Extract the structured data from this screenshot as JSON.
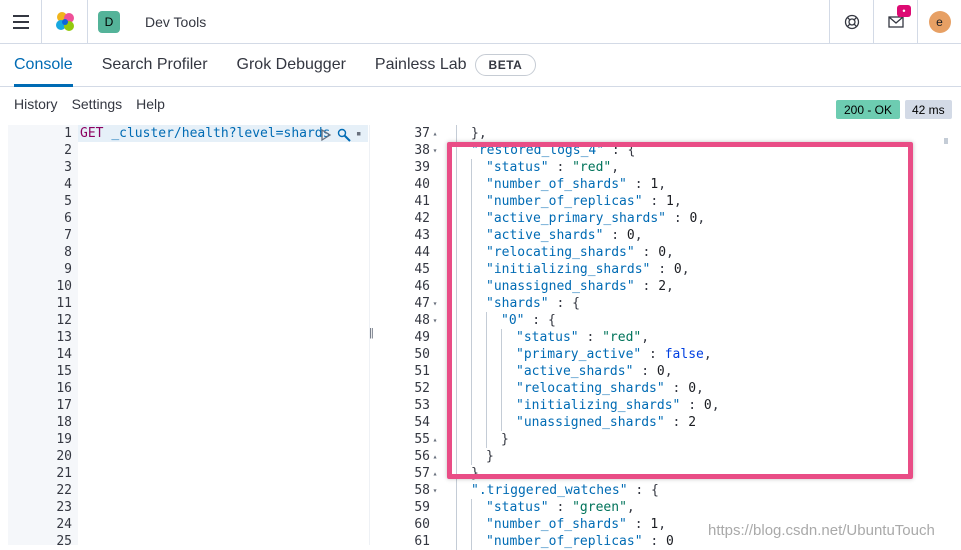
{
  "header": {
    "space_initial": "D",
    "app_title": "Dev Tools",
    "notif_count": "•",
    "avatar_initial": "e"
  },
  "tabs": [
    {
      "label": "Console",
      "active": true
    },
    {
      "label": "Search Profiler"
    },
    {
      "label": "Grok Debugger"
    },
    {
      "label": "Painless Lab"
    }
  ],
  "beta_label": "BETA",
  "menu": {
    "history": "History",
    "settings": "Settings",
    "help": "Help"
  },
  "response_status": "200 - OK",
  "response_time": "42 ms",
  "request": {
    "method": "GET",
    "url": "_cluster/health?level=shards",
    "line_numbers": [
      "1",
      "2",
      "3",
      "4",
      "5",
      "6",
      "7",
      "8",
      "9",
      "10",
      "11",
      "12",
      "13",
      "14",
      "15",
      "16",
      "17",
      "18",
      "19",
      "20",
      "21",
      "22",
      "23",
      "24",
      "25"
    ]
  },
  "response_lines": [
    {
      "n": "37",
      "fold": "▴",
      "indent": 1,
      "parts": [
        [
          "punc",
          "},"
        ]
      ]
    },
    {
      "n": "38",
      "fold": "▾",
      "indent": 1,
      "parts": [
        [
          "key",
          "\"restored_logs_4\""
        ],
        [
          "punc",
          " : {"
        ]
      ]
    },
    {
      "n": "39",
      "fold": "",
      "indent": 2,
      "parts": [
        [
          "key",
          "\"status\""
        ],
        [
          "punc",
          " : "
        ],
        [
          "str",
          "\"red\""
        ],
        [
          "punc",
          ","
        ]
      ]
    },
    {
      "n": "40",
      "fold": "",
      "indent": 2,
      "parts": [
        [
          "key",
          "\"number_of_shards\""
        ],
        [
          "punc",
          " : "
        ],
        [
          "num",
          "1"
        ],
        [
          "punc",
          ","
        ]
      ]
    },
    {
      "n": "41",
      "fold": "",
      "indent": 2,
      "parts": [
        [
          "key",
          "\"number_of_replicas\""
        ],
        [
          "punc",
          " : "
        ],
        [
          "num",
          "1"
        ],
        [
          "punc",
          ","
        ]
      ]
    },
    {
      "n": "42",
      "fold": "",
      "indent": 2,
      "parts": [
        [
          "key",
          "\"active_primary_shards\""
        ],
        [
          "punc",
          " : "
        ],
        [
          "num",
          "0"
        ],
        [
          "punc",
          ","
        ]
      ]
    },
    {
      "n": "43",
      "fold": "",
      "indent": 2,
      "parts": [
        [
          "key",
          "\"active_shards\""
        ],
        [
          "punc",
          " : "
        ],
        [
          "num",
          "0"
        ],
        [
          "punc",
          ","
        ]
      ]
    },
    {
      "n": "44",
      "fold": "",
      "indent": 2,
      "parts": [
        [
          "key",
          "\"relocating_shards\""
        ],
        [
          "punc",
          " : "
        ],
        [
          "num",
          "0"
        ],
        [
          "punc",
          ","
        ]
      ]
    },
    {
      "n": "45",
      "fold": "",
      "indent": 2,
      "parts": [
        [
          "key",
          "\"initializing_shards\""
        ],
        [
          "punc",
          " : "
        ],
        [
          "num",
          "0"
        ],
        [
          "punc",
          ","
        ]
      ]
    },
    {
      "n": "46",
      "fold": "",
      "indent": 2,
      "parts": [
        [
          "key",
          "\"unassigned_shards\""
        ],
        [
          "punc",
          " : "
        ],
        [
          "num",
          "2"
        ],
        [
          "punc",
          ","
        ]
      ]
    },
    {
      "n": "47",
      "fold": "▾",
      "indent": 2,
      "parts": [
        [
          "key",
          "\"shards\""
        ],
        [
          "punc",
          " : {"
        ]
      ]
    },
    {
      "n": "48",
      "fold": "▾",
      "indent": 3,
      "parts": [
        [
          "key",
          "\"0\""
        ],
        [
          "punc",
          " : {"
        ]
      ]
    },
    {
      "n": "49",
      "fold": "",
      "indent": 4,
      "parts": [
        [
          "key",
          "\"status\""
        ],
        [
          "punc",
          " : "
        ],
        [
          "str",
          "\"red\""
        ],
        [
          "punc",
          ","
        ]
      ]
    },
    {
      "n": "50",
      "fold": "",
      "indent": 4,
      "parts": [
        [
          "key",
          "\"primary_active\""
        ],
        [
          "punc",
          " : "
        ],
        [
          "kw",
          "false"
        ],
        [
          "punc",
          ","
        ]
      ]
    },
    {
      "n": "51",
      "fold": "",
      "indent": 4,
      "parts": [
        [
          "key",
          "\"active_shards\""
        ],
        [
          "punc",
          " : "
        ],
        [
          "num",
          "0"
        ],
        [
          "punc",
          ","
        ]
      ]
    },
    {
      "n": "52",
      "fold": "",
      "indent": 4,
      "parts": [
        [
          "key",
          "\"relocating_shards\""
        ],
        [
          "punc",
          " : "
        ],
        [
          "num",
          "0"
        ],
        [
          "punc",
          ","
        ]
      ]
    },
    {
      "n": "53",
      "fold": "",
      "indent": 4,
      "parts": [
        [
          "key",
          "\"initializing_shards\""
        ],
        [
          "punc",
          " : "
        ],
        [
          "num",
          "0"
        ],
        [
          "punc",
          ","
        ]
      ]
    },
    {
      "n": "54",
      "fold": "",
      "indent": 4,
      "parts": [
        [
          "key",
          "\"unassigned_shards\""
        ],
        [
          "punc",
          " : "
        ],
        [
          "num",
          "2"
        ]
      ]
    },
    {
      "n": "55",
      "fold": "▴",
      "indent": 3,
      "parts": [
        [
          "punc",
          "}"
        ]
      ]
    },
    {
      "n": "56",
      "fold": "▴",
      "indent": 2,
      "parts": [
        [
          "punc",
          "}"
        ]
      ]
    },
    {
      "n": "57",
      "fold": "▴",
      "indent": 1,
      "parts": [
        [
          "punc",
          "},"
        ]
      ]
    },
    {
      "n": "58",
      "fold": "▾",
      "indent": 1,
      "parts": [
        [
          "key",
          "\".triggered_watches\""
        ],
        [
          "punc",
          " : {"
        ]
      ]
    },
    {
      "n": "59",
      "fold": "",
      "indent": 2,
      "parts": [
        [
          "key",
          "\"status\""
        ],
        [
          "punc",
          " : "
        ],
        [
          "str",
          "\"green\""
        ],
        [
          "punc",
          ","
        ]
      ]
    },
    {
      "n": "60",
      "fold": "",
      "indent": 2,
      "parts": [
        [
          "key",
          "\"number_of_shards\""
        ],
        [
          "punc",
          " : "
        ],
        [
          "num",
          "1"
        ],
        [
          "punc",
          ","
        ]
      ]
    },
    {
      "n": "61",
      "fold": "",
      "indent": 2,
      "parts": [
        [
          "key",
          "\"number_of_replicas\""
        ],
        [
          "punc",
          " : "
        ],
        [
          "num",
          "0"
        ]
      ]
    }
  ],
  "watermark": "https://blog.csdn.net/UbuntuTouch",
  "colors": {
    "accent": "#006bb4",
    "ok_badge": "#6dccb1",
    "highlight": "#e94d86"
  }
}
